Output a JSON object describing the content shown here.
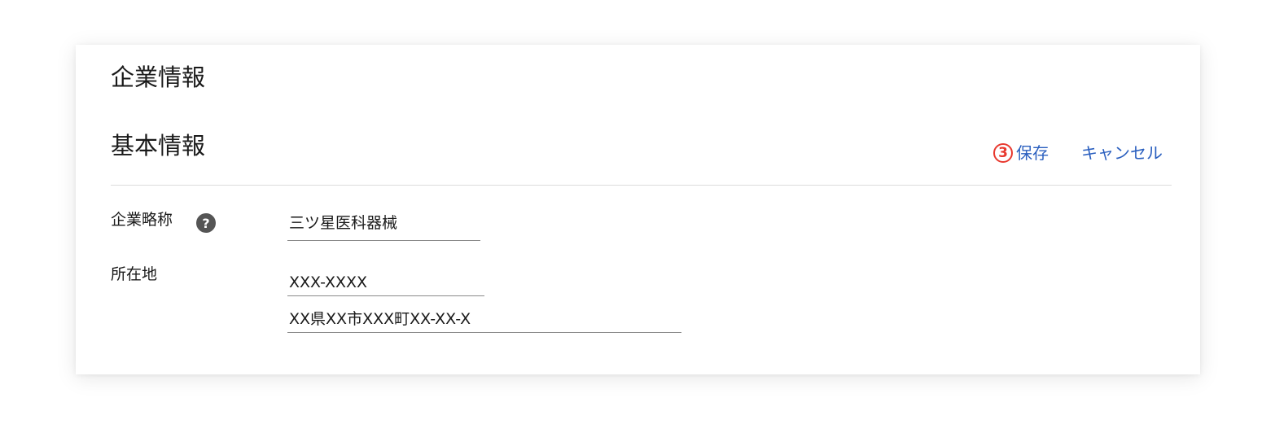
{
  "page": {
    "title": "企業情報"
  },
  "section": {
    "title": "基本情報"
  },
  "actions": {
    "step_number": "3",
    "save_label": "保存",
    "cancel_label": "キャンセル"
  },
  "fields": {
    "company_short_name": {
      "label": "企業略称",
      "help_icon": "question-mark",
      "value": "三ツ星医科器械"
    },
    "address": {
      "label": "所在地",
      "postal_code": "XXX-XXXX",
      "street": "XX県XX市XXX町XX-XX-X"
    }
  },
  "colors": {
    "accent_link": "#2a5fbf",
    "step_badge": "#e8392f",
    "help_icon_bg": "#555555"
  }
}
